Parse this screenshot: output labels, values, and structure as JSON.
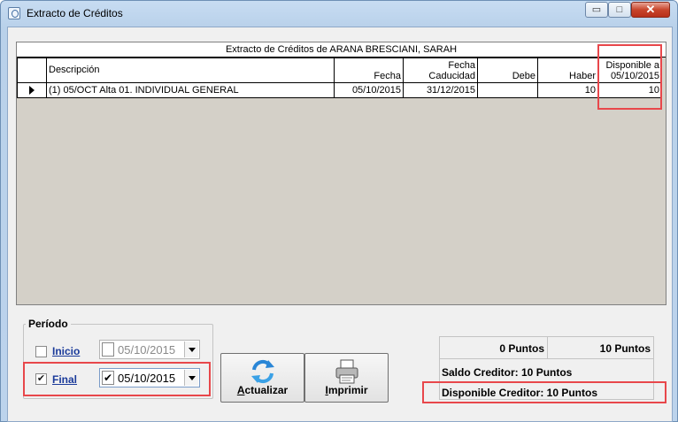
{
  "window": {
    "title": "Extracto de Créditos",
    "buttons": {
      "minimize": "▭",
      "maximize": "□",
      "close": "✕"
    }
  },
  "grid": {
    "caption": "Extracto de Créditos de ARANA BRESCIANI, SARAH",
    "columns": {
      "descripcion": "Descripción",
      "fecha": "Fecha",
      "fecha_caducidad_1": "Fecha",
      "fecha_caducidad_2": "Caducidad",
      "debe": "Debe",
      "haber": "Haber",
      "disponible_1": "Disponible a",
      "disponible_2": "05/10/2015"
    },
    "rows": [
      {
        "descripcion": "(1) 05/OCT Alta 01. INDIVIDUAL GENERAL",
        "fecha": "05/10/2015",
        "fecha_caducidad": "31/12/2015",
        "debe": "",
        "haber": "10",
        "disponible": "10"
      }
    ]
  },
  "periodo": {
    "legend": "Período",
    "inicio": {
      "label": "Inicio",
      "checked": false,
      "date": "05/10/2015",
      "date_checked": false
    },
    "final": {
      "label": "Final",
      "checked": true,
      "date": "05/10/2015",
      "date_checked": true,
      "check_mark": "✔"
    }
  },
  "actions": {
    "actualizar": {
      "label_u": "A",
      "label_rest": "ctualizar",
      "icon": "refresh-icon"
    },
    "imprimir": {
      "label_u": "I",
      "label_rest": "mprimir",
      "icon": "printer-icon"
    }
  },
  "totals": {
    "debe_puntos": "0 Puntos",
    "haber_puntos": "10 Puntos",
    "saldo": "Saldo Creditor: 10 Puntos",
    "disponible": "Disponible Creditor: 10 Puntos"
  },
  "colors": {
    "highlight": "#e8474b",
    "link_label": "#1a3a9a",
    "grid_bg": "#d4d0c8"
  }
}
